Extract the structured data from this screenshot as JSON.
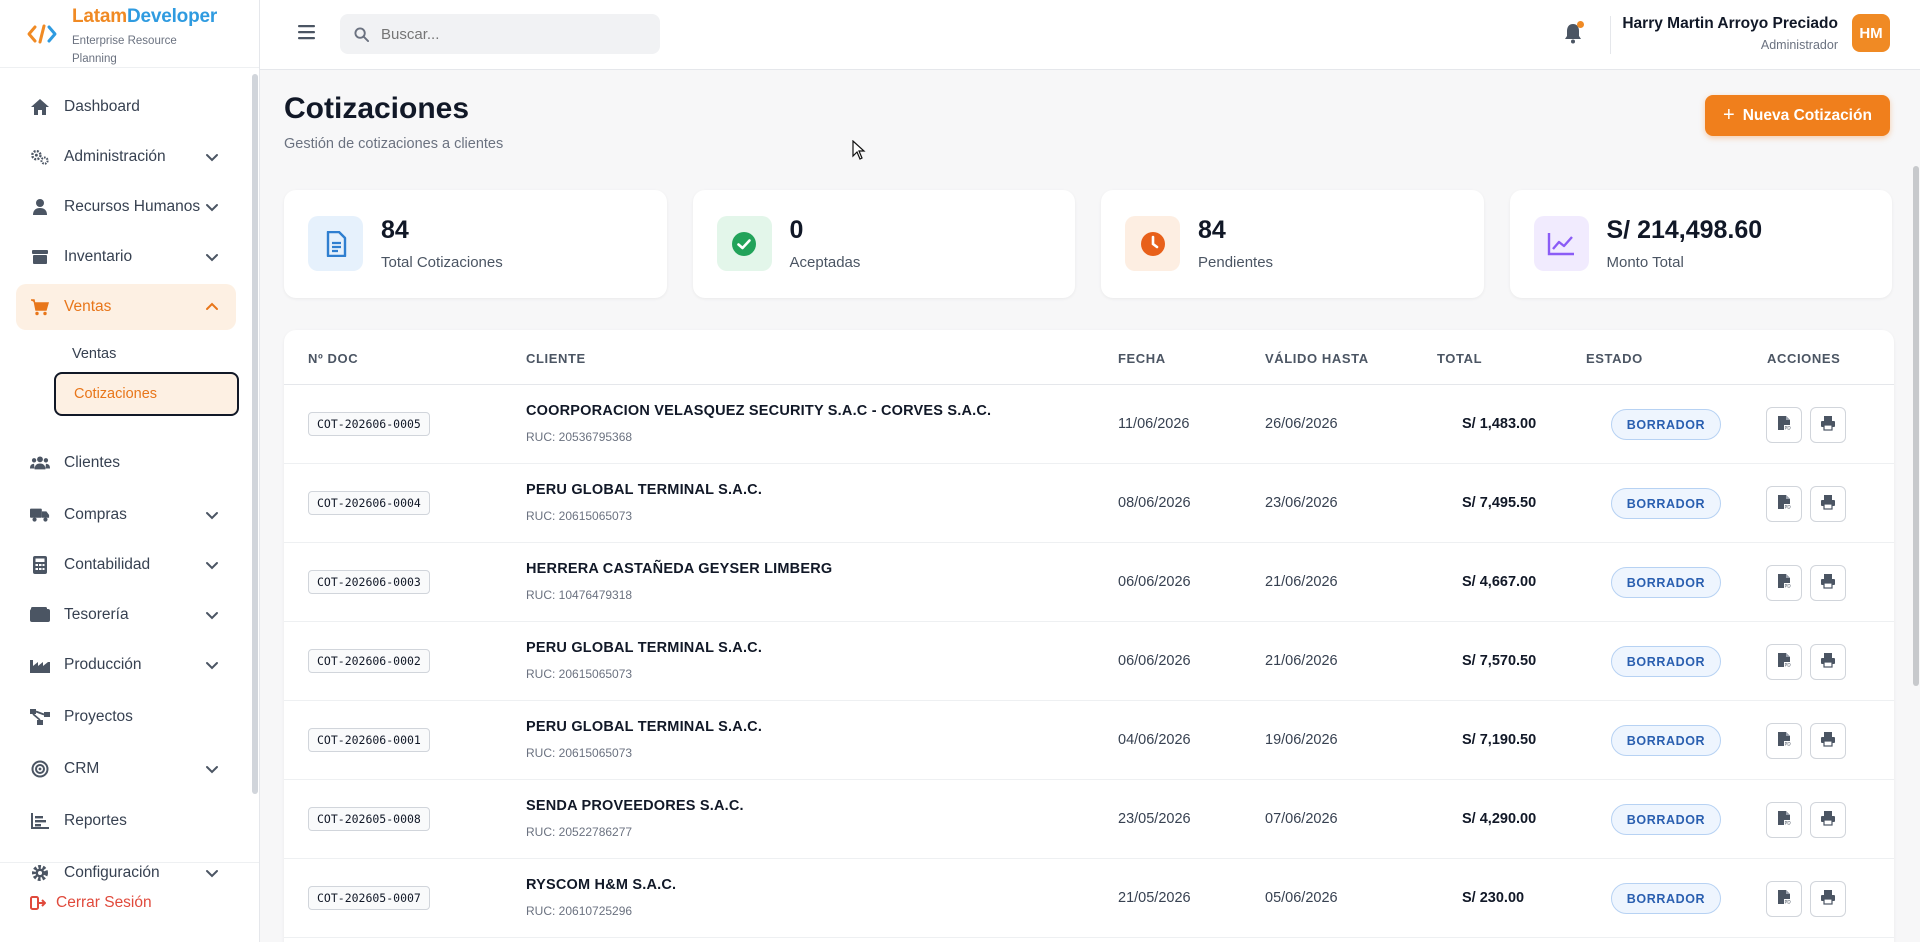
{
  "brand": {
    "name_part1": "Latam",
    "name_part2": "Developer",
    "subtitle": "Enterprise Resource Planning"
  },
  "sidebar": {
    "items": [
      {
        "label": "Dashboard",
        "icon": "home-icon",
        "has_chevron": false
      },
      {
        "label": "Administración",
        "icon": "gears-icon",
        "has_chevron": true
      },
      {
        "label": "Recursos Humanos",
        "icon": "user-tie-icon",
        "has_chevron": true
      },
      {
        "label": "Inventario",
        "icon": "box-icon",
        "has_chevron": true
      },
      {
        "label": "Ventas",
        "icon": "cart-icon",
        "has_chevron": true,
        "active": true
      },
      {
        "label": "Clientes",
        "icon": "users-icon",
        "has_chevron": false
      },
      {
        "label": "Compras",
        "icon": "truck-icon",
        "has_chevron": true
      },
      {
        "label": "Contabilidad",
        "icon": "calculator-icon",
        "has_chevron": true
      },
      {
        "label": "Tesorería",
        "icon": "wallet-icon",
        "has_chevron": true
      },
      {
        "label": "Producción",
        "icon": "industry-icon",
        "has_chevron": true
      },
      {
        "label": "Proyectos",
        "icon": "diagram-icon",
        "has_chevron": false
      },
      {
        "label": "CRM",
        "icon": "target-icon",
        "has_chevron": true
      },
      {
        "label": "Reportes",
        "icon": "bar-chart-icon",
        "has_chevron": false
      },
      {
        "label": "Configuración",
        "icon": "gear-icon",
        "has_chevron": true
      }
    ],
    "sub_items": [
      {
        "label": "Ventas"
      },
      {
        "label": "Cotizaciones",
        "selected": true
      }
    ],
    "logout_label": "Cerrar Sesión"
  },
  "topbar": {
    "search_placeholder": "Buscar...",
    "user_name": "Harry Martin Arroyo Preciado",
    "user_role": "Administrador",
    "avatar_initials": "HM"
  },
  "page": {
    "title": "Cotizaciones",
    "subtitle": "Gestión de cotizaciones a clientes",
    "new_button_label": "Nueva Cotización"
  },
  "stats": [
    {
      "value": "84",
      "label": "Total Cotizaciones",
      "color": "#2f7fd0",
      "bg": "#e6f1fc",
      "icon": "document-icon"
    },
    {
      "value": "0",
      "label": "Aceptadas",
      "color": "#22a35a",
      "bg": "#e3f6ea",
      "icon": "check-circle-icon"
    },
    {
      "value": "84",
      "label": "Pendientes",
      "color": "#e8601a",
      "bg": "#fdeee2",
      "icon": "clock-icon"
    },
    {
      "value": "S/ 214,498.60",
      "label": "Monto Total",
      "color": "#8b5cf6",
      "bg": "#f1ebfe",
      "icon": "line-chart-icon"
    }
  ],
  "table": {
    "headers": {
      "doc": "Nº DOC",
      "client": "CLIENTE",
      "date": "FECHA",
      "valid": "VÁLIDO HASTA",
      "total": "TOTAL",
      "status": "ESTADO",
      "actions": "ACCIONES"
    },
    "rows": [
      {
        "doc": "COT-202606-0005",
        "client": "COORPORACION VELASQUEZ SECURITY S.A.C - CORVES S.A.C.",
        "ruc": "RUC: 20536795368",
        "date": "11/06/2026",
        "valid": "26/06/2026",
        "total": "S/ 1,483.00",
        "status": "BORRADOR"
      },
      {
        "doc": "COT-202606-0004",
        "client": "PERU GLOBAL TERMINAL S.A.C.",
        "ruc": "RUC: 20615065073",
        "date": "08/06/2026",
        "valid": "23/06/2026",
        "total": "S/ 7,495.50",
        "status": "BORRADOR"
      },
      {
        "doc": "COT-202606-0003",
        "client": "HERRERA CASTAÑEDA GEYSER LIMBERG",
        "ruc": "RUC: 10476479318",
        "date": "06/06/2026",
        "valid": "21/06/2026",
        "total": "S/ 4,667.00",
        "status": "BORRADOR"
      },
      {
        "doc": "COT-202606-0002",
        "client": "PERU GLOBAL TERMINAL S.A.C.",
        "ruc": "RUC: 20615065073",
        "date": "06/06/2026",
        "valid": "21/06/2026",
        "total": "S/ 7,570.50",
        "status": "BORRADOR"
      },
      {
        "doc": "COT-202606-0001",
        "client": "PERU GLOBAL TERMINAL S.A.C.",
        "ruc": "RUC: 20615065073",
        "date": "04/06/2026",
        "valid": "19/06/2026",
        "total": "S/ 7,190.50",
        "status": "BORRADOR"
      },
      {
        "doc": "COT-202605-0008",
        "client": "SENDA PROVEEDORES S.A.C.",
        "ruc": "RUC: 20522786277",
        "date": "23/05/2026",
        "valid": "07/06/2026",
        "total": "S/ 4,290.00",
        "status": "BORRADOR"
      },
      {
        "doc": "COT-202605-0007",
        "client": "RYSCOM H&M S.A.C.",
        "ruc": "RUC: 20610725296",
        "date": "21/05/2026",
        "valid": "05/06/2026",
        "total": "S/ 230.00",
        "status": "BORRADOR"
      }
    ]
  }
}
